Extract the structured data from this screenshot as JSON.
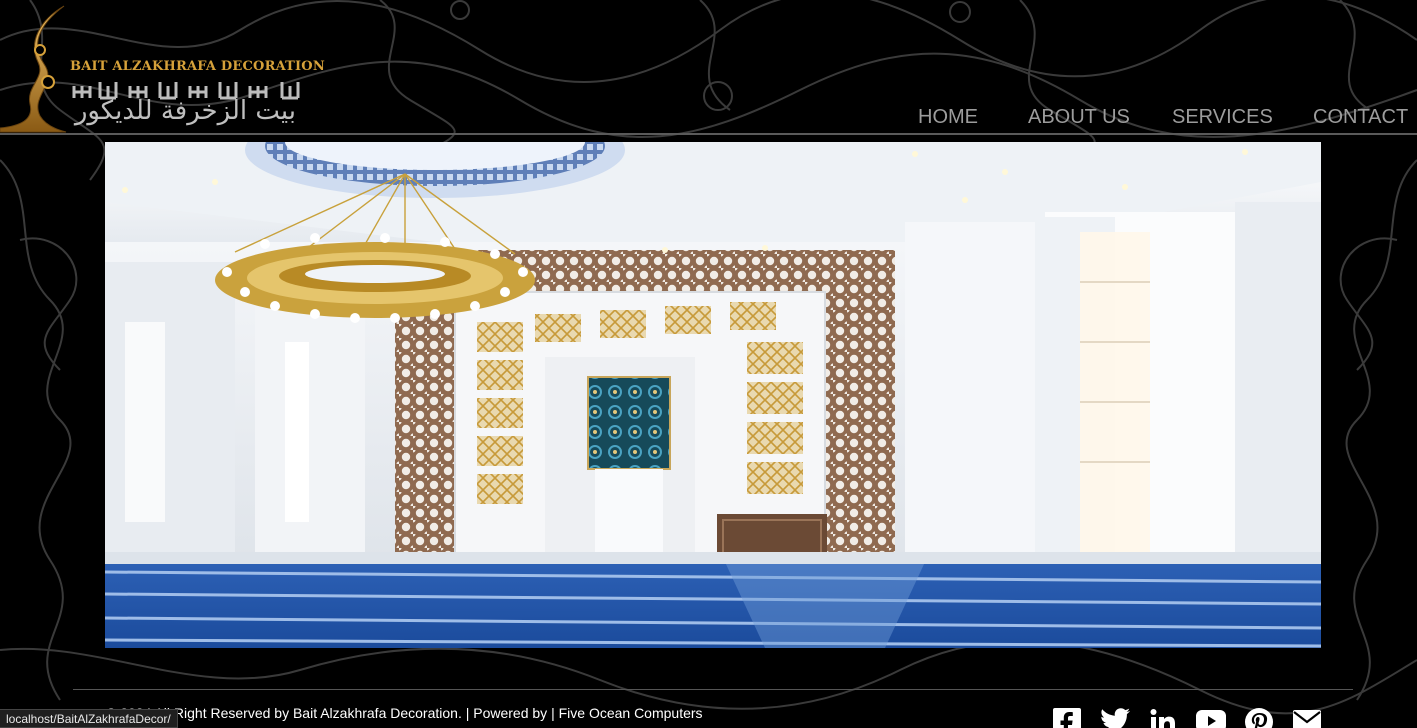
{
  "brand": {
    "name": "BAIT ALZAKHRAFA DECORATION",
    "arabic_name": "بيت الزخرفة للديكور",
    "accent_color": "#d6a13a"
  },
  "nav": {
    "items": [
      {
        "label": "HOME"
      },
      {
        "label": "ABOUT US"
      },
      {
        "label": "SERVICES"
      },
      {
        "label": "CONTACT"
      }
    ]
  },
  "hero": {
    "image": "mosque-interior-mihrab-render"
  },
  "footer": {
    "copyright": "© 2024 All Right Reserved by Bait Alzakhrafa Decoration. | Powered by | Five Ocean Computers",
    "social": [
      {
        "icon": "facebook-icon"
      },
      {
        "icon": "twitter-icon"
      },
      {
        "icon": "linkedin-icon"
      },
      {
        "icon": "youtube-icon"
      },
      {
        "icon": "pinterest-icon"
      },
      {
        "icon": "email-icon"
      }
    ]
  },
  "status_bar": {
    "url": "localhost/BaitAlZakhrafaDecor/"
  }
}
